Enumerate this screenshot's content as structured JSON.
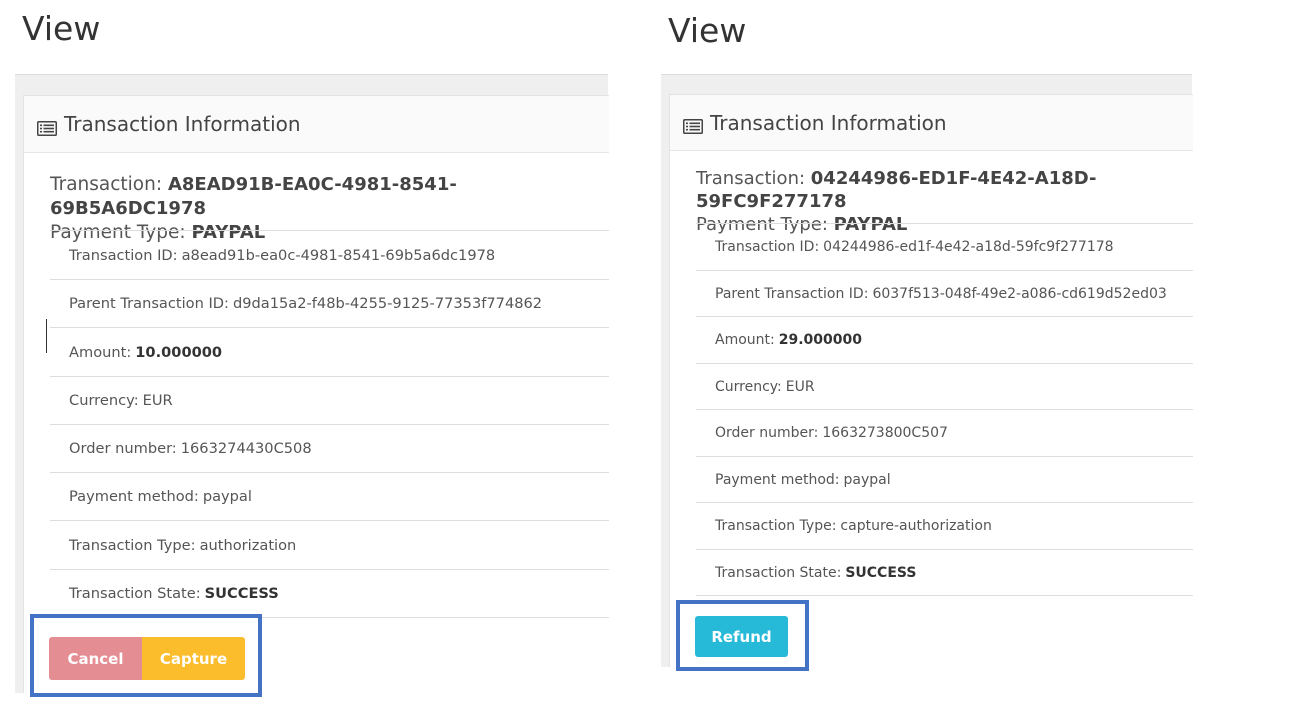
{
  "views": [
    {
      "title": "View",
      "header": "Transaction Information",
      "transaction_label": "Transaction:",
      "transaction_value": "A8EAD91B-EA0C-4981-8541-69B5A6DC1978",
      "payment_type_label": "Payment Type:",
      "payment_type_value": "PAYPAL",
      "items": [
        {
          "label": "Transaction ID:",
          "value": "a8ead91b-ea0c-4981-8541-69b5a6dc1978",
          "bold": false
        },
        {
          "label": "Parent Transaction ID:",
          "value": "d9da15a2-f48b-4255-9125-77353f774862",
          "bold": false
        },
        {
          "label": "Amount:",
          "value": "10.000000",
          "bold": true
        },
        {
          "label": "Currency:",
          "value": "EUR",
          "bold": false
        },
        {
          "label": "Order number:",
          "value": "1663274430C508",
          "bold": false
        },
        {
          "label": "Payment method:",
          "value": "paypal",
          "bold": false
        },
        {
          "label": "Transaction Type:",
          "value": "authorization",
          "bold": false
        },
        {
          "label": "Transaction State:",
          "value": "SUCCESS",
          "bold": true
        }
      ],
      "buttons": {
        "cancel": "Cancel",
        "capture": "Capture"
      }
    },
    {
      "title": "View",
      "header": "Transaction Information",
      "transaction_label": "Transaction:",
      "transaction_value": "04244986-ED1F-4E42-A18D-59FC9F277178",
      "payment_type_label": "Payment Type:",
      "payment_type_value": "PAYPAL",
      "items": [
        {
          "label": "Transaction ID:",
          "value": "04244986-ed1f-4e42-a18d-59fc9f277178",
          "bold": false
        },
        {
          "label": "Parent Transaction ID:",
          "value": "6037f513-048f-49e2-a086-cd619d52ed03",
          "bold": false
        },
        {
          "label": "Amount:",
          "value": "29.000000",
          "bold": true
        },
        {
          "label": "Currency:",
          "value": "EUR",
          "bold": false
        },
        {
          "label": "Order number:",
          "value": "1663273800C507",
          "bold": false
        },
        {
          "label": "Payment method:",
          "value": "paypal",
          "bold": false
        },
        {
          "label": "Transaction Type:",
          "value": "capture-authorization",
          "bold": false
        },
        {
          "label": "Transaction State:",
          "value": "SUCCESS",
          "bold": true
        }
      ],
      "buttons": {
        "refund": "Refund"
      }
    }
  ],
  "colors": {
    "cancel_button": "#e48d93",
    "capture_button": "#fbbd2c",
    "refund_button": "#26b9d8",
    "highlight_border": "#4472c4"
  },
  "icons": {
    "header_icon": "list-alt-icon"
  }
}
